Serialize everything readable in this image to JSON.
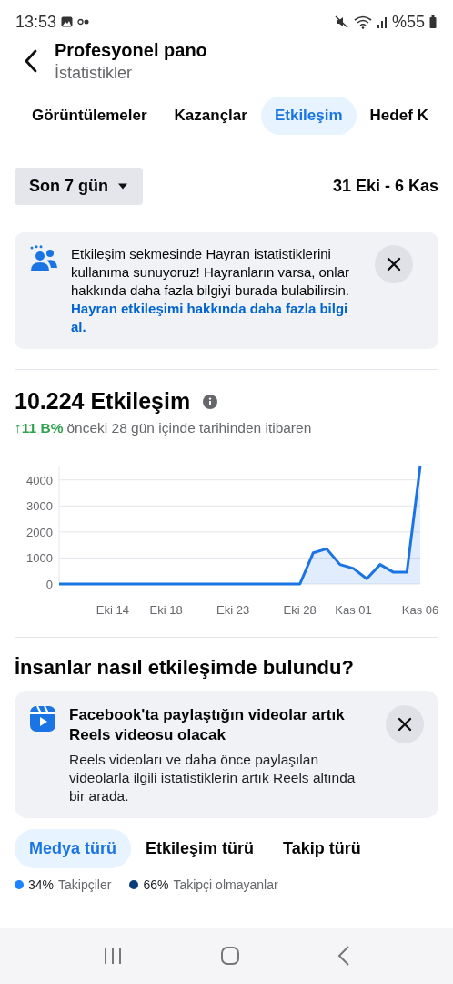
{
  "status_bar": {
    "time": "13:53",
    "battery": "%55"
  },
  "header": {
    "title": "Profesyonel pano",
    "subtitle": "İstatistikler"
  },
  "tabs": [
    {
      "label": "Görüntülemeler",
      "selected": false
    },
    {
      "label": "Kazançlar",
      "selected": false
    },
    {
      "label": "Etkileşim",
      "selected": true
    },
    {
      "label": "Hedef K",
      "selected": false
    }
  ],
  "date_filter": {
    "label": "Son 7 gün",
    "range": "31 Eki - 6 Kas"
  },
  "info_banner": {
    "text": "Etkileşim sekmesinde Hayran istatistiklerini kullanıma sunuyoruz! Hayranların varsa, onlar hakkında daha fazla bilgiyi burada bulabilirsin.",
    "link": "Hayran etkileşimi hakkında daha fazla bilgi al."
  },
  "metric": {
    "value": "10.224 Etkileşim",
    "change": "↑11 B%",
    "change_text": "önceki 28 gün içinde tarihinden itibaren",
    "chart_data": {
      "type": "area",
      "categories": [
        null,
        null,
        null,
        null,
        "Eki 14",
        null,
        null,
        null,
        "Eki 18",
        null,
        null,
        null,
        null,
        "Eki 23",
        null,
        null,
        null,
        null,
        "Eki 28",
        null,
        null,
        null,
        "Kas 01",
        null,
        null,
        null,
        null,
        "Kas 06"
      ],
      "series": [
        {
          "color": "#1b74e4",
          "values": [
            0,
            0,
            0,
            0,
            0,
            0,
            0,
            0,
            0,
            0,
            0,
            0,
            0,
            0,
            0,
            0,
            0,
            0,
            0,
            1200,
            1350,
            750,
            600,
            200,
            750,
            450,
            450,
            4550
          ]
        }
      ],
      "ylim": [
        0,
        4550
      ],
      "yticks": [
        0,
        1000,
        2000,
        3000,
        4000
      ],
      "grid": true
    }
  },
  "section_title": "İnsanlar nasıl etkileşimde bulundu?",
  "reels_banner": {
    "title": "Facebook'ta paylaştığın videolar artık Reels videosu olacak",
    "text": "Reels videoları ve daha önce paylaşılan videolarla ilgili istatistiklerin artık Reels altında bir arada."
  },
  "breakdown_tabs": [
    {
      "label": "Medya türü",
      "selected": true
    },
    {
      "label": "Etkileşim türü",
      "selected": false
    },
    {
      "label": "Takip türü",
      "selected": false
    }
  ],
  "legend": [
    {
      "percent": "34%",
      "label": "Takipçiler",
      "color": "#1b84ff"
    },
    {
      "percent": "66%",
      "label": "Takipçi olmayanlar",
      "color": "#0a3d7a"
    }
  ]
}
